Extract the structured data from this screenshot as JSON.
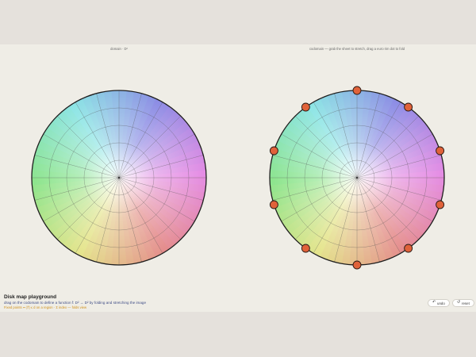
{
  "panels": {
    "domain_label": "domain · D²",
    "codomain_label": "codomain — grab the sheet to stretch, drag a euro rim dot to fold"
  },
  "info": {
    "title": "Disk map playground",
    "subtitle": "drag on the codomain to define a function f: D² → D² by folding and stretching the image",
    "hint": "Fixed points ↦ |f'| ≤ d on a region · Σ index — folds view"
  },
  "buttons": {
    "undo_label": "undo",
    "undo_icon": "undo-arrow-icon",
    "reset_label": "reset",
    "reset_icon": "reset-icon"
  },
  "colors": {
    "rim_handle_fill": "#e0623a",
    "rim_handle_stroke": "#2a1a14",
    "disk_outline": "#1f1f1f",
    "grid": "#4f4f4f"
  },
  "grid": {
    "rings": 5,
    "spokes": 24
  },
  "rim_handles": {
    "count": 10
  }
}
